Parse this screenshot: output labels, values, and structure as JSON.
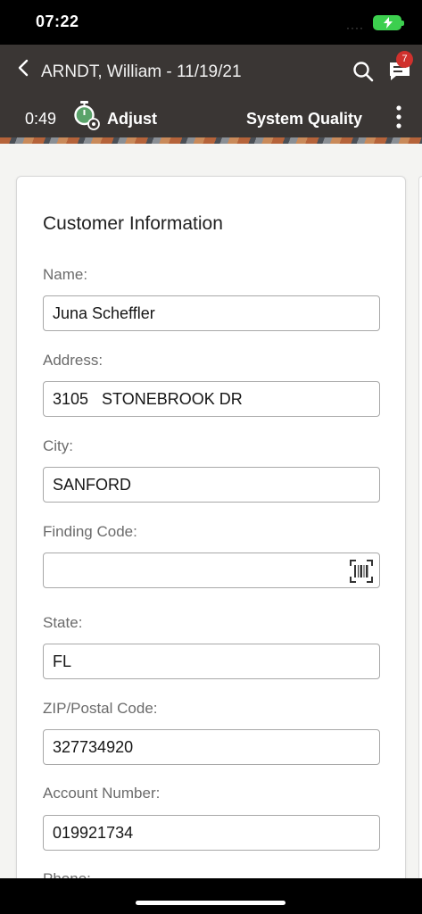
{
  "status": {
    "time": "07:22",
    "signal": "····"
  },
  "header": {
    "title": "ARNDT, William - 11/19/21",
    "notification_count": "7",
    "timer": "0:49",
    "adjust_label": "Adjust",
    "system_label": "System Quality"
  },
  "colors": {
    "header_bg": "#3a3634",
    "badge": "#d0312d",
    "battery": "#3ccf4e"
  },
  "form": {
    "title": "Customer Information",
    "fields": [
      {
        "label": "Name:",
        "value": "Juna Scheffler"
      },
      {
        "label": "Address:",
        "value": "3105   STONEBROOK DR"
      },
      {
        "label": "City:",
        "value": "SANFORD"
      },
      {
        "label": "Finding Code:",
        "value": ""
      },
      {
        "label": "State:",
        "value": "FL"
      },
      {
        "label": "ZIP/Postal Code:",
        "value": "327734920"
      },
      {
        "label": "Account Number:",
        "value": "019921734"
      },
      {
        "label": "Phone:",
        "value": ""
      }
    ]
  }
}
